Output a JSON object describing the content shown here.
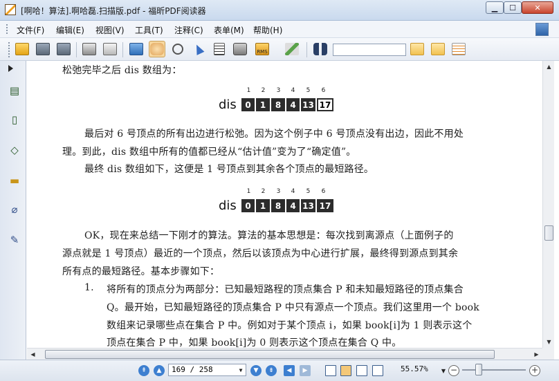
{
  "window": {
    "title": "[啊哈！算法].啊哈磊.扫描版.pdf - 福昕PDF阅读器",
    "min_glyph": "▁",
    "max_glyph": "☐",
    "close_glyph": "✕"
  },
  "menu": [
    {
      "label": "文件(F)"
    },
    {
      "label": "编辑(E)"
    },
    {
      "label": "视图(V)"
    },
    {
      "label": "工具(T)"
    },
    {
      "label": "注释(C)"
    },
    {
      "label": "表单(M)"
    },
    {
      "label": "帮助(H)"
    }
  ],
  "toolbar": {
    "icons": [
      "open-icon",
      "save-icon",
      "save-as-icon",
      "print-icon",
      "scanner-icon",
      "screen-icon",
      "hand-tool-icon",
      "zoom-tool-icon",
      "select-arrow-icon",
      "text-select-icon",
      "snapshot-icon",
      "rms-lock-icon",
      "typewriter-icon",
      "binoculars-icon",
      "find-prev-icon",
      "find-next-icon",
      "highlight-icon"
    ],
    "rms_label": "RMS",
    "search_value": ""
  },
  "left_panel": {
    "icons": [
      "bookmarks-icon",
      "pages-icon",
      "layers-icon",
      "comments-icon",
      "attachments-icon",
      "signatures-icon"
    ]
  },
  "page": {
    "line1": "松弛完毕之后 dis 数组为：",
    "dis_label": "dis",
    "indices": [
      "1",
      "2",
      "3",
      "4",
      "5",
      "6"
    ],
    "dis_values_1": [
      "0",
      "1",
      "8",
      "4",
      "13",
      "17"
    ],
    "dis_values_2": [
      "0",
      "1",
      "8",
      "4",
      "13",
      "17"
    ],
    "para1_l1": "最后对 6 号顶点的所有出边进行松弛。因为这个例子中 6 号顶点没有出边，因此不用处",
    "para1_l2": "理。到此，dis 数组中所有的值都已经从“估计值”变为了“确定值”。",
    "para1_l3": "最终 dis 数组如下，这便是 1 号顶点到其余各个顶点的最短路径。",
    "para2_l1": "OK，现在来总结一下刚才的算法。算法的基本思想是：每次找到离源点（上面例子的",
    "para2_l2": "源点就是 1 号顶点）最近的一个顶点，然后以该顶点为中心进行扩展，最终得到源点到其余",
    "para2_l3": "所有点的最短路径。基本步骤如下：",
    "item_num": "1.",
    "item_l1": "将所有的顶点分为两部分：已知最短路程的顶点集合 P 和未知最短路径的顶点集合",
    "item_l2": "Q。最开始，已知最短路径的顶点集合 P 中只有源点一个顶点。我们这里用一个 book",
    "item_l3": "数组来记录哪些点在集合 P 中。例如对于某个顶点 i，如果 book[i]为 1 则表示这个",
    "item_l4": "顶点在集合 P 中，如果 book[i]为 0 则表示这个顶点在集合 Q 中。"
  },
  "status": {
    "page_input": "169 / 258",
    "zoom": "55.57%",
    "zoom_minus": "−",
    "zoom_plus": "+"
  }
}
